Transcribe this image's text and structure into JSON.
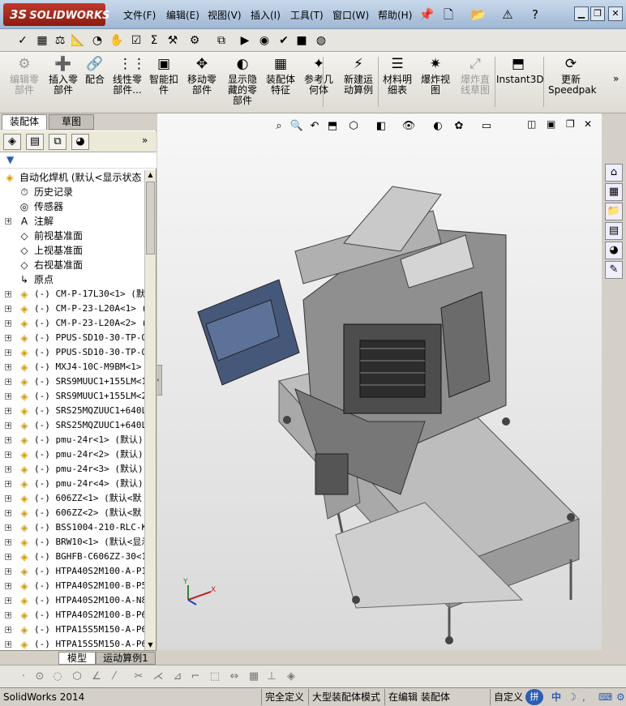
{
  "app": {
    "logo_text": "SOLIDWORKS",
    "logo_mark": "3S"
  },
  "menu": [
    "文件(F)",
    "编辑(E)",
    "视图(V)",
    "插入(I)",
    "工具(T)",
    "窗口(W)",
    "帮助(H)"
  ],
  "command_manager": [
    {
      "label": "编辑零\n部件",
      "icon": "edit-component-icon",
      "disabled": true
    },
    {
      "label": "插入零\n部件",
      "icon": "insert-component-icon",
      "disabled": false
    },
    {
      "label": "配合",
      "icon": "mate-icon",
      "disabled": false
    },
    {
      "label": "线性零\n部件...",
      "icon": "linear-pattern-icon",
      "disabled": false
    },
    {
      "label": "智能扣\n件",
      "icon": "smart-fastener-icon",
      "disabled": false
    },
    {
      "label": "移动零\n部件",
      "icon": "move-component-icon",
      "disabled": false
    },
    {
      "label": "显示隐\n藏的零\n部件",
      "icon": "show-hidden-icon",
      "disabled": false
    },
    {
      "label": "装配体\n特征",
      "icon": "assembly-feature-icon",
      "disabled": false
    },
    {
      "label": "参考几\n何体",
      "icon": "reference-geometry-icon",
      "disabled": false
    },
    {
      "label": "新建运\n动算例",
      "icon": "new-motion-study-icon",
      "disabled": false
    },
    {
      "label": "材料明\n细表",
      "icon": "bom-icon",
      "disabled": false
    },
    {
      "label": "爆炸视\n图",
      "icon": "exploded-view-icon",
      "disabled": false
    },
    {
      "label": "爆炸直\n线草图",
      "icon": "explode-line-sketch-icon",
      "disabled": true
    },
    {
      "label": "Instant3D",
      "icon": "instant3d-icon",
      "disabled": false
    },
    {
      "label": "更新\nSpeedpak",
      "icon": "speedpak-icon",
      "disabled": false
    }
  ],
  "panel_tabs": {
    "assembly": "装配体",
    "sketch": "草图"
  },
  "tree": {
    "root": "自动化焊机  (默认<显示状态",
    "items": [
      {
        "label": "历史记录",
        "icon": "history-icon",
        "expandable": false
      },
      {
        "label": "传感器",
        "icon": "sensor-icon",
        "expandable": false
      },
      {
        "label": "注解",
        "icon": "annotation-icon",
        "expandable": true
      },
      {
        "label": "前视基准面",
        "icon": "plane-icon",
        "expandable": false
      },
      {
        "label": "上视基准面",
        "icon": "plane-icon",
        "expandable": false
      },
      {
        "label": "右视基准面",
        "icon": "plane-icon",
        "expandable": false
      },
      {
        "label": "原点",
        "icon": "origin-icon",
        "expandable": false
      },
      {
        "label": "(-) CM-P-17L30<1> (默认",
        "icon": "component-icon",
        "expandable": true
      },
      {
        "label": "(-) CM-P-23-L20A<1> (默",
        "icon": "component-icon",
        "expandable": true
      },
      {
        "label": "(-) CM-P-23-L20A<2> (默",
        "icon": "component-icon",
        "expandable": true
      },
      {
        "label": "(-) PPUS-SD10-30-TP-QS",
        "icon": "component-icon",
        "expandable": true
      },
      {
        "label": "(-) PPUS-SD10-30-TP-QS",
        "icon": "component-icon",
        "expandable": true
      },
      {
        "label": "(-) MXJ4-10C-M9BM<1> (",
        "icon": "component-icon",
        "expandable": true
      },
      {
        "label": "(-) SRS9MUUC1+155LM<1>",
        "icon": "component-icon",
        "expandable": true
      },
      {
        "label": "(-) SRS9MUUC1+155LM<2>",
        "icon": "component-icon",
        "expandable": true
      },
      {
        "label": "(-) SRS25MQZUUC1+640LM",
        "icon": "component-icon",
        "expandable": true
      },
      {
        "label": "(-) SRS25MQZUUC1+640LM",
        "icon": "component-icon",
        "expandable": true
      },
      {
        "label": "(-) pmu-24r<1> (默认)",
        "icon": "component-icon",
        "expandable": true
      },
      {
        "label": "(-) pmu-24r<2> (默认)",
        "icon": "component-icon",
        "expandable": true
      },
      {
        "label": "(-) pmu-24r<3> (默认)",
        "icon": "component-icon",
        "expandable": true
      },
      {
        "label": "(-) pmu-24r<4> (默认)",
        "icon": "component-icon",
        "expandable": true
      },
      {
        "label": "(-) 606ZZ<1> (默认<默",
        "icon": "component-icon",
        "expandable": true
      },
      {
        "label": "(-) 606ZZ<2> (默认<默",
        "icon": "component-icon",
        "expandable": true
      },
      {
        "label": "(-) BSS1004-210-RLC-KC",
        "icon": "component-icon",
        "expandable": true
      },
      {
        "label": "(-) BRW10<1> (默认<显示",
        "icon": "component-icon",
        "expandable": true
      },
      {
        "label": "(-) BGHFB-C606ZZ-30<1>",
        "icon": "component-icon",
        "expandable": true
      },
      {
        "label": "(-) HTPA40S2M100-A-P12",
        "icon": "component-icon",
        "expandable": true
      },
      {
        "label": "(-) HTPA40S2M100-B-P5<",
        "icon": "component-icon",
        "expandable": true
      },
      {
        "label": "(-) HTPA40S2M100-A-N8<",
        "icon": "component-icon",
        "expandable": true
      },
      {
        "label": "(-) HTPA40S2M100-B-P6.",
        "icon": "component-icon",
        "expandable": true
      },
      {
        "label": "(-) HTPA15S5M150-A-P6.",
        "icon": "component-icon",
        "expandable": true
      },
      {
        "label": "(-) HTPA15S5M150-A-P6<",
        "icon": "component-icon",
        "expandable": true
      }
    ]
  },
  "bottom_tabs": {
    "model": "模型",
    "motion": "运动算例1"
  },
  "status": {
    "app_version": "SolidWorks 2014",
    "fully_defined": "完全定义",
    "large_assembly": "大型装配体模式",
    "editing": "在编辑 装配体",
    "custom": "自定义"
  },
  "ime": {
    "mode": "中"
  },
  "colors": {
    "accent": "#c0392b",
    "viewport_top": "#f7f7f7",
    "viewport_bottom": "#d9d9d9"
  }
}
